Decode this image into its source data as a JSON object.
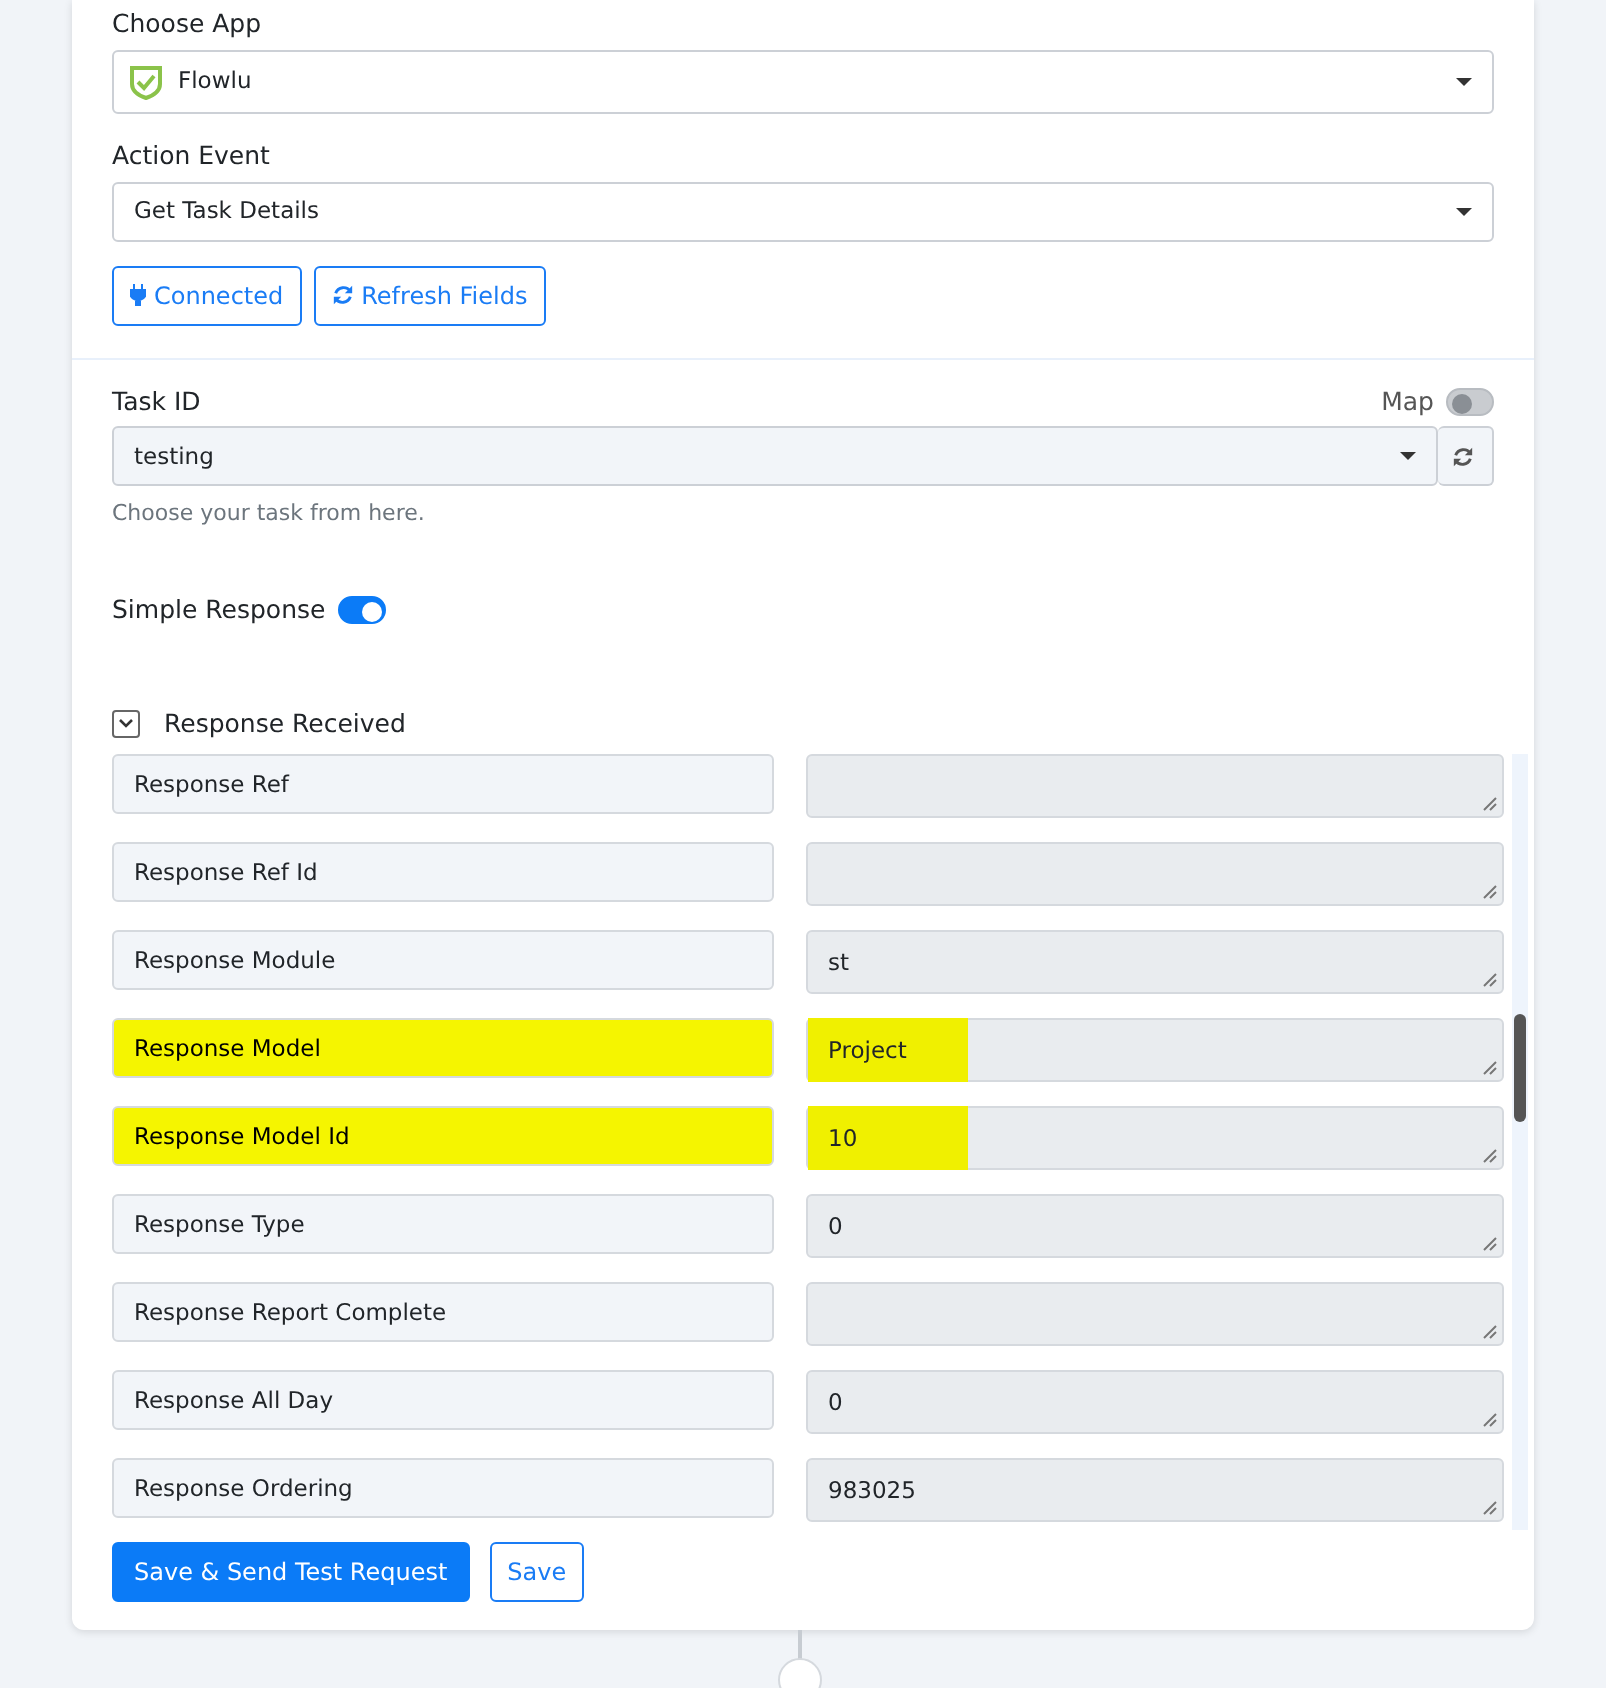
{
  "choose_app": {
    "label": "Choose App",
    "value": "Flowlu"
  },
  "action_event": {
    "label": "Action Event",
    "value": "Get Task Details"
  },
  "buttons": [
    {
      "kind": "connect",
      "label": "Connected"
    },
    {
      "kind": "refresh",
      "label": "Refresh Fields"
    }
  ],
  "task_id": {
    "label": "Task ID",
    "map_label": "Map",
    "map_on": false,
    "value": "testing",
    "help": "Choose your task from here."
  },
  "simple_response": {
    "label": "Simple Response",
    "on": true
  },
  "response_received": {
    "label": "Response Received",
    "expanded": true
  },
  "fields": [
    {
      "label": "Response Ref",
      "highlighted": false
    },
    {
      "label": "Response Ref Id",
      "highlighted": false
    },
    {
      "label": "Response Module",
      "value": "st",
      "highlighted": false
    },
    {
      "label": "Response Model",
      "value": "Project",
      "highlighted": true
    },
    {
      "label": "Response Model Id",
      "value": "10",
      "highlighted": true
    },
    {
      "label": "Response Type",
      "value": "0",
      "highlighted": false
    },
    {
      "label": "Response Report Complete",
      "highlighted": false
    },
    {
      "label": "Response All Day",
      "value": "0",
      "highlighted": false
    },
    {
      "label": "Response Ordering",
      "value": "983025",
      "highlighted": false
    }
  ],
  "footer_buttons": [
    {
      "kind": "primary",
      "label": "Save & Send Test Request"
    },
    {
      "kind": "outline",
      "label": "Save"
    }
  ]
}
